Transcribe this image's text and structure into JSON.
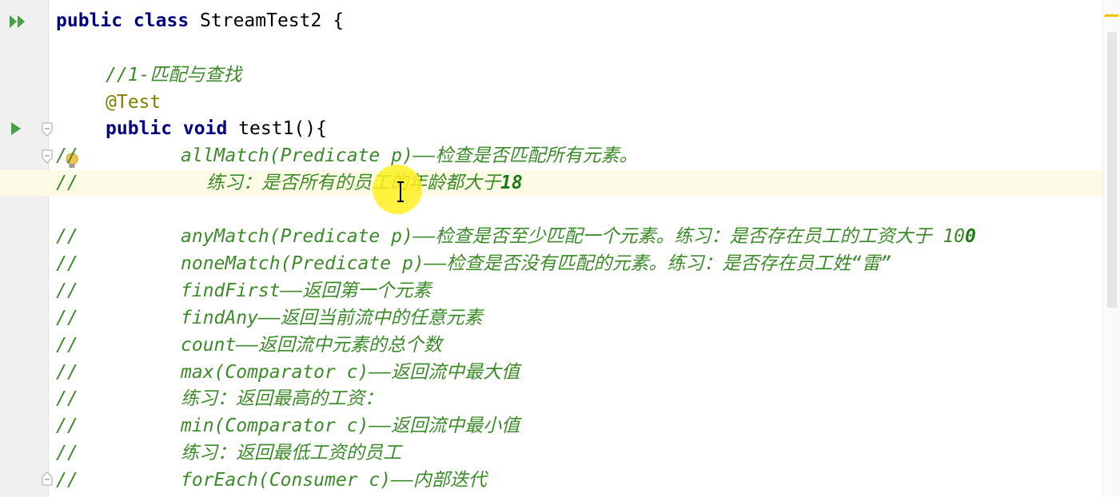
{
  "colors": {
    "keyword": "#000080",
    "annotation": "#808000",
    "comment": "#3d8a2a",
    "gutter_bg": "#f0f0f0",
    "current_line": "#fdfbe6",
    "run_icon": "#4a9e4a",
    "cursor_highlight": "#ffef1e"
  },
  "icons": {
    "run_class": "run-double-arrow-icon",
    "run_method": "run-arrow-icon",
    "bulb": "lightbulb-icon",
    "fold": "fold-marker-icon",
    "video_play": "video-play-icon"
  },
  "code": {
    "class_decl": {
      "kw": "public class",
      "name": "StreamTest2 {"
    },
    "comment_title": "//1-匹配与查找",
    "annotation": "@Test",
    "method_decl": {
      "kw": "public void",
      "name": "test1(){"
    },
    "lines": [
      {
        "prefix": "//",
        "text": "allMatch(Predicate p)——检查是否匹配所有元素。"
      },
      {
        "prefix": "//",
        "text": "练习：是否所有的员工的年龄都大于",
        "num": "18"
      },
      {
        "prefix": "//",
        "text": "anyMatch(Predicate p)——检查是否至少匹配一个元素。练习：是否存在员工的工资大于 10",
        "num": "0"
      },
      {
        "prefix": "//",
        "text": "noneMatch(Predicate p)——检查是否没有匹配的元素。练习：是否存在员工姓“雷”"
      },
      {
        "prefix": "//",
        "text": "findFirst——返回第一个元素"
      },
      {
        "prefix": "//",
        "text": "findAny——返回当前流中的任意元素"
      },
      {
        "prefix": "//",
        "text": "count——返回流中元素的总个数"
      },
      {
        "prefix": "//",
        "text": "max(Comparator c)——返回流中最大值"
      },
      {
        "prefix": "//",
        "text": "练习：返回最高的工资："
      },
      {
        "prefix": "//",
        "text": "min(Comparator c)——返回流中最小值"
      },
      {
        "prefix": "//",
        "text": "练习：返回最低工资的员工"
      },
      {
        "prefix": "//",
        "text": "forEach(Consumer c)——内部迭代"
      }
    ]
  }
}
